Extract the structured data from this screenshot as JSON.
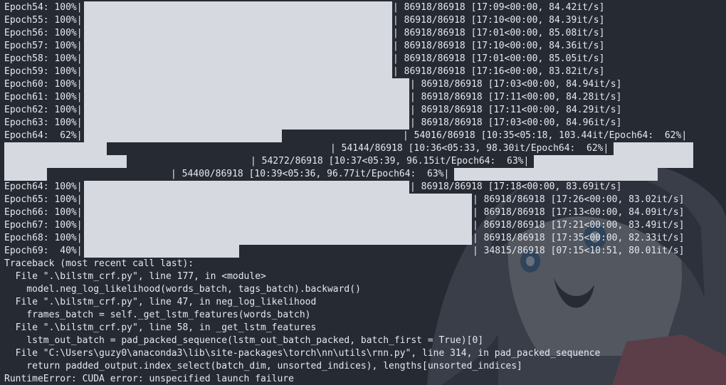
{
  "terminal": {
    "epochs_a": [
      {
        "label": "Epoch54: 100%|",
        "stats": "| 86918/86918 [17:09<00:00, 84.42it/s]"
      },
      {
        "label": "Epoch55: 100%|",
        "stats": "| 86918/86918 [17:10<00:00, 84.39it/s]"
      },
      {
        "label": "Epoch56: 100%|",
        "stats": "| 86918/86918 [17:01<00:00, 85.08it/s]"
      },
      {
        "label": "Epoch57: 100%|",
        "stats": "| 86918/86918 [17:10<00:00, 84.36it/s]"
      },
      {
        "label": "Epoch58: 100%|",
        "stats": "| 86918/86918 [17:01<00:00, 85.05it/s]"
      },
      {
        "label": "Epoch59: 100%|",
        "stats": "| 86918/86918 [17:16<00:00, 83.82it/s]"
      }
    ],
    "epochs_b": [
      {
        "label": "Epoch60: 100%|",
        "stats": "| 86918/86918 [17:03<00:00, 84.94it/s]"
      },
      {
        "label": "Epoch61: 100%|",
        "stats": "| 86918/86918 [17:11<00:00, 84.28it/s]"
      },
      {
        "label": "Epoch62: 100%|",
        "stats": "| 86918/86918 [17:11<00:00, 84.29it/s]"
      },
      {
        "label": "Epoch63: 100%|",
        "stats": "| 86918/86918 [17:03<00:00, 84.96it/s]"
      }
    ],
    "epoch64_partial": {
      "label": "Epoch64:  62%|",
      "seg1": "| 54016/86918 [10:35<05:18, 103.44it/Epoch64:  62%|",
      "seg2": "| 54144/86918 [10:36<05:33, 98.30it/Epoch64:  62%|",
      "seg3": "| 54272/86918 [10:37<05:39, 96.15it/Epoch64:  63%|",
      "seg4": "| 54400/86918 [10:39<05:36, 96.77it/Epoch64:  63%|"
    },
    "epoch64_final": {
      "label": "Epoch64: 100%|",
      "stats": "| 86918/86918 [17:18<00:00, 83.69it/s]"
    },
    "epochs_c": [
      {
        "label": "Epoch65: 100%|",
        "stats": "| 86918/86918 [17:26<00:00, 83.02it/s]"
      },
      {
        "label": "Epoch66: 100%|",
        "stats": "| 86918/86918 [17:13<00:00, 84.09it/s]"
      },
      {
        "label": "Epoch67: 100%|",
        "stats": "| 86918/86918 [17:21<00:00, 83.49it/s]"
      },
      {
        "label": "Epoch68: 100%|",
        "stats": "| 86918/86918 [17:35<00:00, 82.33it/s]"
      },
      {
        "label": "Epoch69:  40%|",
        "stats": "| 34815/86918 [07:15<10:51, 80.01it/s]",
        "progress": 0.4
      }
    ],
    "traceback": [
      "Traceback (most recent call last):",
      "  File \".\\bilstm_crf.py\", line 177, in <module>",
      "    model.neg_log_likelihood(words_batch, tags_batch).backward()",
      "  File \".\\bilstm_crf.py\", line 47, in neg_log_likelihood",
      "    frames_batch = self._get_lstm_features(words_batch)",
      "  File \".\\bilstm_crf.py\", line 58, in _get_lstm_features",
      "    lstm_out_batch = pad_packed_sequence(lstm_out_batch_packed, batch_first = True)[0]",
      "  File \"C:\\Users\\guzy0\\anaconda3\\lib\\site-packages\\torch\\nn\\utils\\rnn.py\", line 314, in pad_packed_sequence",
      "    return padded_output.index_select(batch_dim, unsorted_indices), lengths[unsorted_indices]"
    ],
    "error": "RuntimeError: CUDA error: unspecified launch failure",
    "colors": {
      "background": "#262a33",
      "text": "#e6e8ee",
      "bar": "#d6d9e0"
    }
  }
}
